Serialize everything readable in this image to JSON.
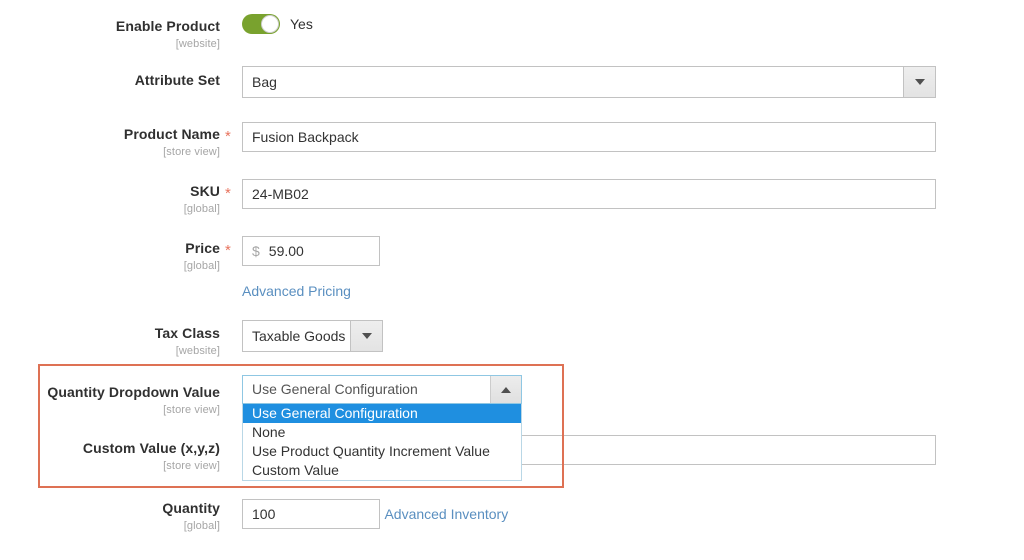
{
  "form": {
    "enable_product": {
      "label": "Enable Product",
      "scope": "[website]",
      "toggle_state_label": "Yes",
      "toggle_color": "#79a22e"
    },
    "attribute_set": {
      "label": "Attribute Set",
      "value": "Bag",
      "arrow_icon": "chevron-down-icon"
    },
    "product_name": {
      "label": "Product Name",
      "scope": "[store view]",
      "required_marker": "*",
      "value": "Fusion Backpack"
    },
    "sku": {
      "label": "SKU",
      "scope": "[global]",
      "required_marker": "*",
      "value": "24-MB02"
    },
    "price": {
      "label": "Price",
      "scope": "[global]",
      "required_marker": "*",
      "currency_symbol": "$",
      "value": "59.00",
      "advanced_link": "Advanced Pricing"
    },
    "tax_class": {
      "label": "Tax Class",
      "scope": "[website]",
      "value": "Taxable Goods",
      "arrow_icon": "chevron-down-icon"
    },
    "quantity_dropdown_value": {
      "label": "Quantity Dropdown Value",
      "scope": "[store view]",
      "value": "Use General Configuration",
      "arrow_icon": "chevron-up-icon",
      "expanded": true,
      "options": [
        "Use General Configuration",
        "None",
        "Use Product Quantity Increment Value",
        "Custom Value"
      ],
      "selected_index": 0,
      "selected_bg": "#1f8fe0"
    },
    "custom_value": {
      "label": "Custom Value (x,y,z)",
      "scope": "[store view]",
      "value": "",
      "placeholder": ""
    },
    "quantity": {
      "label": "Quantity",
      "scope": "[global]",
      "value": "100",
      "advanced_link": "Advanced Inventory"
    }
  },
  "highlight": {
    "color": "#de7154",
    "name": "quantity-dropdown-highlight"
  }
}
